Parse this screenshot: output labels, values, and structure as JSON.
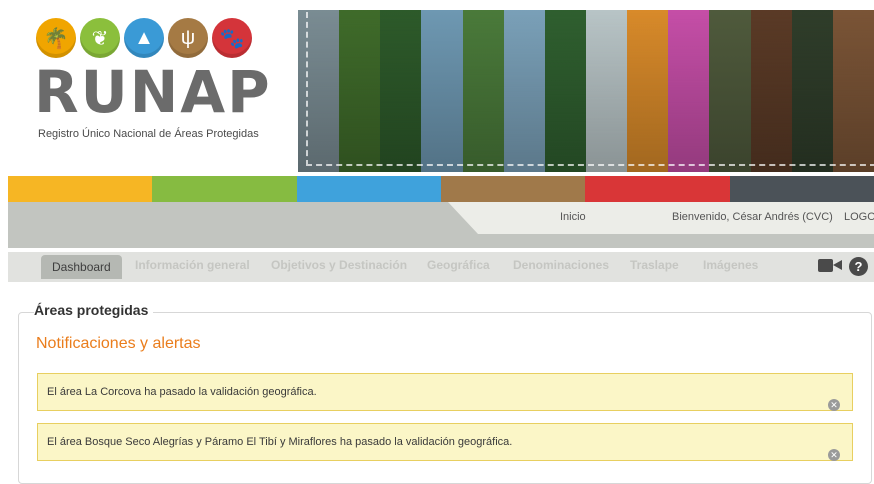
{
  "brand": {
    "name": "RUNAP",
    "tagline": "Registro Único Nacional de Áreas Protegidas",
    "icons": [
      {
        "name": "palm-tree-icon",
        "glyph": "🌴",
        "color": "#f0a500"
      },
      {
        "name": "leaf-icon",
        "glyph": "❦",
        "color": "#8bbf3c"
      },
      {
        "name": "mountain-icon",
        "glyph": "▲",
        "color": "#3a9ad6"
      },
      {
        "name": "grass-icon",
        "glyph": "ψ",
        "color": "#a57a44"
      },
      {
        "name": "animal-icon",
        "glyph": "🐾",
        "color": "#d4343a"
      }
    ]
  },
  "color_band": [
    "#f6b624",
    "#86bb41",
    "#3fa2dc",
    "#a0794a",
    "#d93637",
    "#4b5258"
  ],
  "photo_strip": [
    "#7a8c93",
    "#3f6b2a",
    "#2d5a2a",
    "#6e98b2",
    "#4a7a3a",
    "#7aa0b8",
    "#2f5f2f",
    "#b8c4c6",
    "#d88a2a",
    "#c54ea7",
    "#4f5a3c",
    "#5a3a26",
    "#2f3d2a",
    "#7a5436"
  ],
  "user_bar": {
    "home_label": "Inicio",
    "welcome_text": "Bienvenido, César Andrés (CVC)",
    "logout_label": "LOGOUT"
  },
  "tabs": {
    "dashboard": "Dashboard",
    "general_info": "Información general",
    "objectives": "Objetivos y Destinación",
    "geographic": "Geográfica",
    "denominations": "Denominaciones",
    "overlap": "Traslape",
    "images": "Imágenes"
  },
  "content": {
    "section_title": "Áreas protegidas",
    "notifications_title": "Notificaciones y alertas",
    "alerts": [
      {
        "text": "El área La Corcova ha pasado la validación geográfica."
      },
      {
        "text": "El área Bosque Seco Alegrías y Páramo El Tibí y Miraflores ha pasado la validación geográfica."
      }
    ]
  }
}
